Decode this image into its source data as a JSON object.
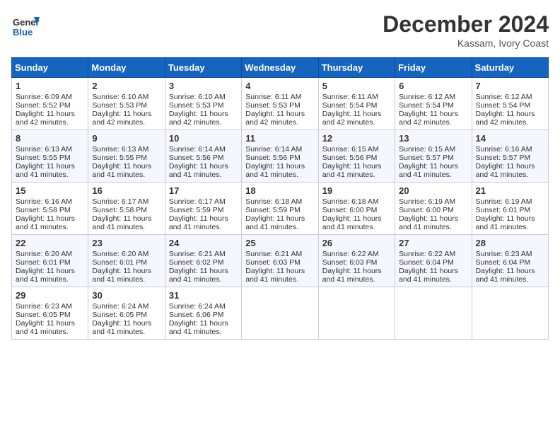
{
  "header": {
    "logo_general": "General",
    "logo_blue": "Blue",
    "title": "December 2024",
    "location": "Kassam, Ivory Coast"
  },
  "weekdays": [
    "Sunday",
    "Monday",
    "Tuesday",
    "Wednesday",
    "Thursday",
    "Friday",
    "Saturday"
  ],
  "weeks": [
    [
      {
        "day": "1",
        "lines": [
          "Sunrise: 6:09 AM",
          "Sunset: 5:52 PM",
          "Daylight: 11 hours",
          "and 42 minutes."
        ]
      },
      {
        "day": "2",
        "lines": [
          "Sunrise: 6:10 AM",
          "Sunset: 5:53 PM",
          "Daylight: 11 hours",
          "and 42 minutes."
        ]
      },
      {
        "day": "3",
        "lines": [
          "Sunrise: 6:10 AM",
          "Sunset: 5:53 PM",
          "Daylight: 11 hours",
          "and 42 minutes."
        ]
      },
      {
        "day": "4",
        "lines": [
          "Sunrise: 6:11 AM",
          "Sunset: 5:53 PM",
          "Daylight: 11 hours",
          "and 42 minutes."
        ]
      },
      {
        "day": "5",
        "lines": [
          "Sunrise: 6:11 AM",
          "Sunset: 5:54 PM",
          "Daylight: 11 hours",
          "and 42 minutes."
        ]
      },
      {
        "day": "6",
        "lines": [
          "Sunrise: 6:12 AM",
          "Sunset: 5:54 PM",
          "Daylight: 11 hours",
          "and 42 minutes."
        ]
      },
      {
        "day": "7",
        "lines": [
          "Sunrise: 6:12 AM",
          "Sunset: 5:54 PM",
          "Daylight: 11 hours",
          "and 42 minutes."
        ]
      }
    ],
    [
      {
        "day": "8",
        "lines": [
          "Sunrise: 6:13 AM",
          "Sunset: 5:55 PM",
          "Daylight: 11 hours",
          "and 41 minutes."
        ]
      },
      {
        "day": "9",
        "lines": [
          "Sunrise: 6:13 AM",
          "Sunset: 5:55 PM",
          "Daylight: 11 hours",
          "and 41 minutes."
        ]
      },
      {
        "day": "10",
        "lines": [
          "Sunrise: 6:14 AM",
          "Sunset: 5:56 PM",
          "Daylight: 11 hours",
          "and 41 minutes."
        ]
      },
      {
        "day": "11",
        "lines": [
          "Sunrise: 6:14 AM",
          "Sunset: 5:56 PM",
          "Daylight: 11 hours",
          "and 41 minutes."
        ]
      },
      {
        "day": "12",
        "lines": [
          "Sunrise: 6:15 AM",
          "Sunset: 5:56 PM",
          "Daylight: 11 hours",
          "and 41 minutes."
        ]
      },
      {
        "day": "13",
        "lines": [
          "Sunrise: 6:15 AM",
          "Sunset: 5:57 PM",
          "Daylight: 11 hours",
          "and 41 minutes."
        ]
      },
      {
        "day": "14",
        "lines": [
          "Sunrise: 6:16 AM",
          "Sunset: 5:57 PM",
          "Daylight: 11 hours",
          "and 41 minutes."
        ]
      }
    ],
    [
      {
        "day": "15",
        "lines": [
          "Sunrise: 6:16 AM",
          "Sunset: 5:58 PM",
          "Daylight: 11 hours",
          "and 41 minutes."
        ]
      },
      {
        "day": "16",
        "lines": [
          "Sunrise: 6:17 AM",
          "Sunset: 5:58 PM",
          "Daylight: 11 hours",
          "and 41 minutes."
        ]
      },
      {
        "day": "17",
        "lines": [
          "Sunrise: 6:17 AM",
          "Sunset: 5:59 PM",
          "Daylight: 11 hours",
          "and 41 minutes."
        ]
      },
      {
        "day": "18",
        "lines": [
          "Sunrise: 6:18 AM",
          "Sunset: 5:59 PM",
          "Daylight: 11 hours",
          "and 41 minutes."
        ]
      },
      {
        "day": "19",
        "lines": [
          "Sunrise: 6:18 AM",
          "Sunset: 6:00 PM",
          "Daylight: 11 hours",
          "and 41 minutes."
        ]
      },
      {
        "day": "20",
        "lines": [
          "Sunrise: 6:19 AM",
          "Sunset: 6:00 PM",
          "Daylight: 11 hours",
          "and 41 minutes."
        ]
      },
      {
        "day": "21",
        "lines": [
          "Sunrise: 6:19 AM",
          "Sunset: 6:01 PM",
          "Daylight: 11 hours",
          "and 41 minutes."
        ]
      }
    ],
    [
      {
        "day": "22",
        "lines": [
          "Sunrise: 6:20 AM",
          "Sunset: 6:01 PM",
          "Daylight: 11 hours",
          "and 41 minutes."
        ]
      },
      {
        "day": "23",
        "lines": [
          "Sunrise: 6:20 AM",
          "Sunset: 6:01 PM",
          "Daylight: 11 hours",
          "and 41 minutes."
        ]
      },
      {
        "day": "24",
        "lines": [
          "Sunrise: 6:21 AM",
          "Sunset: 6:02 PM",
          "Daylight: 11 hours",
          "and 41 minutes."
        ]
      },
      {
        "day": "25",
        "lines": [
          "Sunrise: 6:21 AM",
          "Sunset: 6:03 PM",
          "Daylight: 11 hours",
          "and 41 minutes."
        ]
      },
      {
        "day": "26",
        "lines": [
          "Sunrise: 6:22 AM",
          "Sunset: 6:03 PM",
          "Daylight: 11 hours",
          "and 41 minutes."
        ]
      },
      {
        "day": "27",
        "lines": [
          "Sunrise: 6:22 AM",
          "Sunset: 6:04 PM",
          "Daylight: 11 hours",
          "and 41 minutes."
        ]
      },
      {
        "day": "28",
        "lines": [
          "Sunrise: 6:23 AM",
          "Sunset: 6:04 PM",
          "Daylight: 11 hours",
          "and 41 minutes."
        ]
      }
    ],
    [
      {
        "day": "29",
        "lines": [
          "Sunrise: 6:23 AM",
          "Sunset: 6:05 PM",
          "Daylight: 11 hours",
          "and 41 minutes."
        ]
      },
      {
        "day": "30",
        "lines": [
          "Sunrise: 6:24 AM",
          "Sunset: 6:05 PM",
          "Daylight: 11 hours",
          "and 41 minutes."
        ]
      },
      {
        "day": "31",
        "lines": [
          "Sunrise: 6:24 AM",
          "Sunset: 6:06 PM",
          "Daylight: 11 hours",
          "and 41 minutes."
        ]
      },
      {
        "day": "",
        "lines": []
      },
      {
        "day": "",
        "lines": []
      },
      {
        "day": "",
        "lines": []
      },
      {
        "day": "",
        "lines": []
      }
    ]
  ]
}
